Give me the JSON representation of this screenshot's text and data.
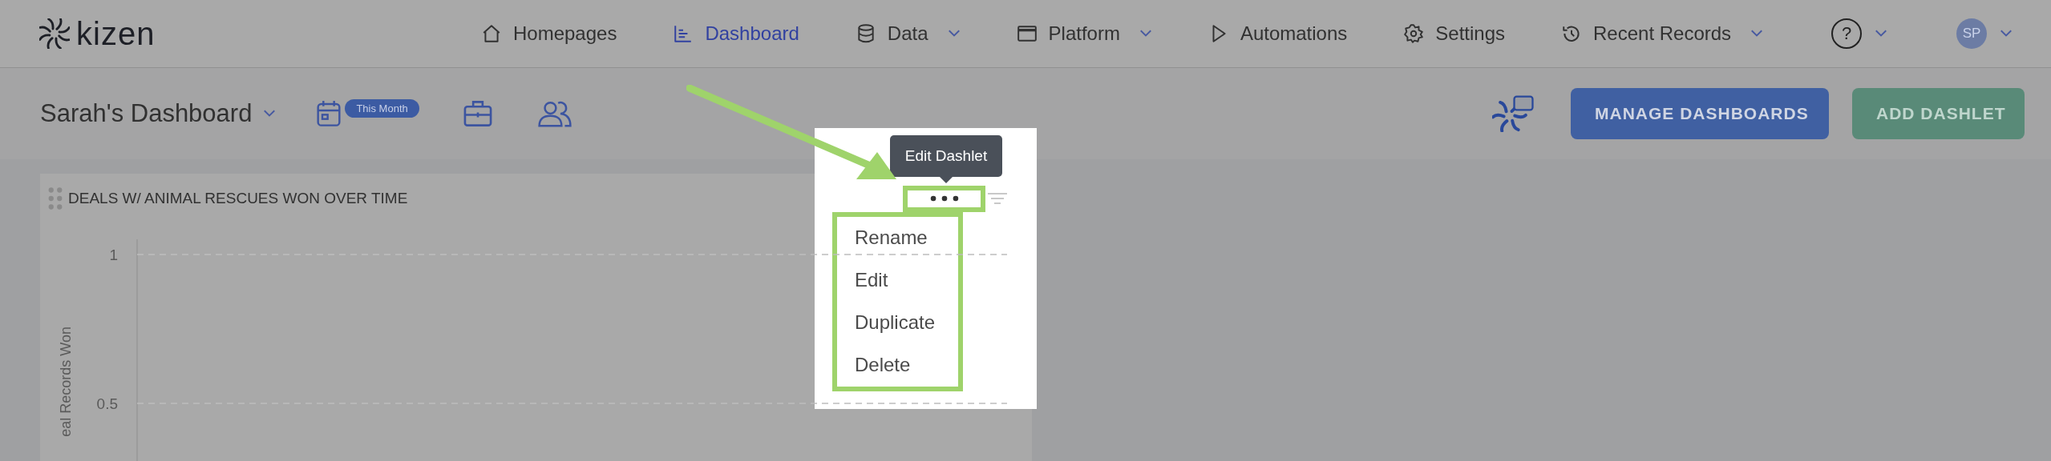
{
  "header": {
    "logo": "kizen",
    "nav": [
      {
        "label": "Homepages",
        "kind": "home",
        "selected": false,
        "dropdown": false
      },
      {
        "label": "Dashboard",
        "kind": "chart",
        "selected": true,
        "dropdown": false
      },
      {
        "label": "Data",
        "kind": "database",
        "selected": false,
        "dropdown": true
      },
      {
        "label": "Platform",
        "kind": "window",
        "selected": false,
        "dropdown": true
      },
      {
        "label": "Automations",
        "kind": "play",
        "selected": false,
        "dropdown": false
      },
      {
        "label": "Settings",
        "kind": "gear",
        "selected": false,
        "dropdown": false
      },
      {
        "label": "Recent Records",
        "kind": "history",
        "selected": false,
        "dropdown": true
      }
    ],
    "help": "?",
    "avatar": "SP"
  },
  "toolbar": {
    "title": "Sarah's Dashboard",
    "date_badge": "This Month",
    "manage_button": "MANAGE DASHBOARDS",
    "add_button": "ADD DASHLET"
  },
  "dashlet": {
    "title": "DEALS W/ ANIMAL RESCUES WON OVER TIME",
    "y_axis_title": "eal Records Won",
    "y_ticks": [
      "1",
      "0.5"
    ]
  },
  "tooltip": "Edit Dashlet",
  "menu": [
    {
      "label": "Rename"
    },
    {
      "label": "Edit"
    },
    {
      "label": "Duplicate"
    },
    {
      "label": "Delete"
    }
  ]
}
